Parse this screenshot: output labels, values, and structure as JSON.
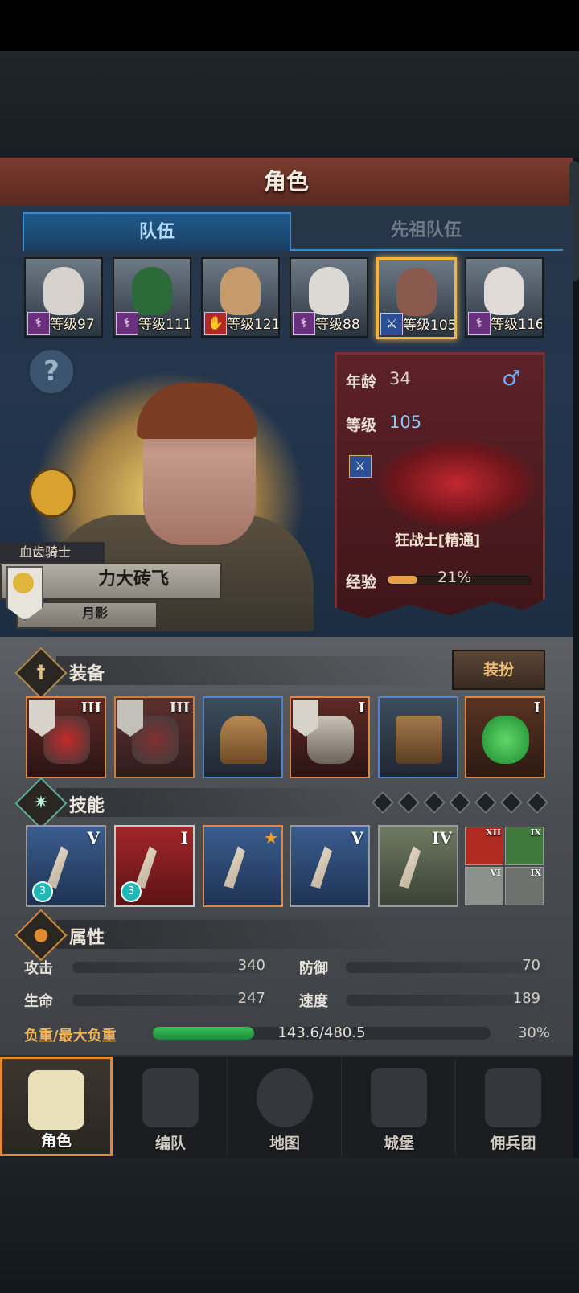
{
  "screen_title": "角色",
  "tabs": {
    "team": "队伍",
    "ancestor": "先祖队伍"
  },
  "heroes": [
    {
      "level": "等级97",
      "selected": false,
      "face": "#d8d2cc"
    },
    {
      "level": "等级111",
      "selected": false,
      "face": "#2d6a3a"
    },
    {
      "level": "等级121",
      "selected": false,
      "face": "#c79a6c"
    },
    {
      "level": "等级88",
      "selected": false,
      "face": "#dcd8d4"
    },
    {
      "level": "等级105",
      "selected": true,
      "face": "#8a5a4e"
    },
    {
      "level": "等级116",
      "selected": false,
      "face": "#e0dad6"
    }
  ],
  "hero_card": {
    "class_title": "血齿骑士",
    "name": "力大砖飞",
    "faction": "月影"
  },
  "stats_card": {
    "age_label": "年龄",
    "age": "34",
    "gender_symbol": "♂",
    "level_label": "等级",
    "level": "105",
    "class_name": "狂战士[精通]",
    "exp_label": "经验",
    "exp_pct": "21%",
    "exp_fraction": 0.21
  },
  "equipment": {
    "title": "装备",
    "dress_button": "装扮",
    "slots": [
      {
        "rank": "III",
        "banner": true,
        "blue": false
      },
      {
        "rank": "III",
        "banner": true,
        "blue": false
      },
      {
        "rank": "",
        "banner": false,
        "blue": true
      },
      {
        "rank": "I",
        "banner": true,
        "blue": false
      },
      {
        "rank": "",
        "banner": false,
        "blue": true
      },
      {
        "rank": "I",
        "banner": false,
        "blue": false
      }
    ]
  },
  "skills": {
    "title": "技能",
    "items": [
      {
        "rank": "V",
        "badge": "3"
      },
      {
        "rank": "I",
        "badge": "3"
      },
      {
        "rank": "★",
        "badge": ""
      },
      {
        "rank": "V",
        "badge": ""
      },
      {
        "rank": "IV",
        "badge": ""
      }
    ],
    "mini": [
      {
        "rank": "XII"
      },
      {
        "rank": "IX"
      },
      {
        "rank": "VI"
      },
      {
        "rank": "IX"
      }
    ]
  },
  "attributes": {
    "title": "属性",
    "attack_label": "攻击",
    "attack": "340",
    "defense_label": "防御",
    "defense": "70",
    "hp_label": "生命",
    "hp": "247",
    "speed_label": "速度",
    "speed": "189",
    "load_label": "负重/最大负重",
    "load_value": "143.6/480.5",
    "load_pct": "30%"
  },
  "nav": {
    "character": "角色",
    "formation": "编队",
    "map": "地图",
    "castle": "城堡",
    "mercenary": "佣兵团"
  },
  "colors": {
    "accent_gold": "#f3b33d",
    "tab_blue": "#3d8bcc",
    "load_green": "#3ac158",
    "exp_orange": "#e6a04a"
  }
}
